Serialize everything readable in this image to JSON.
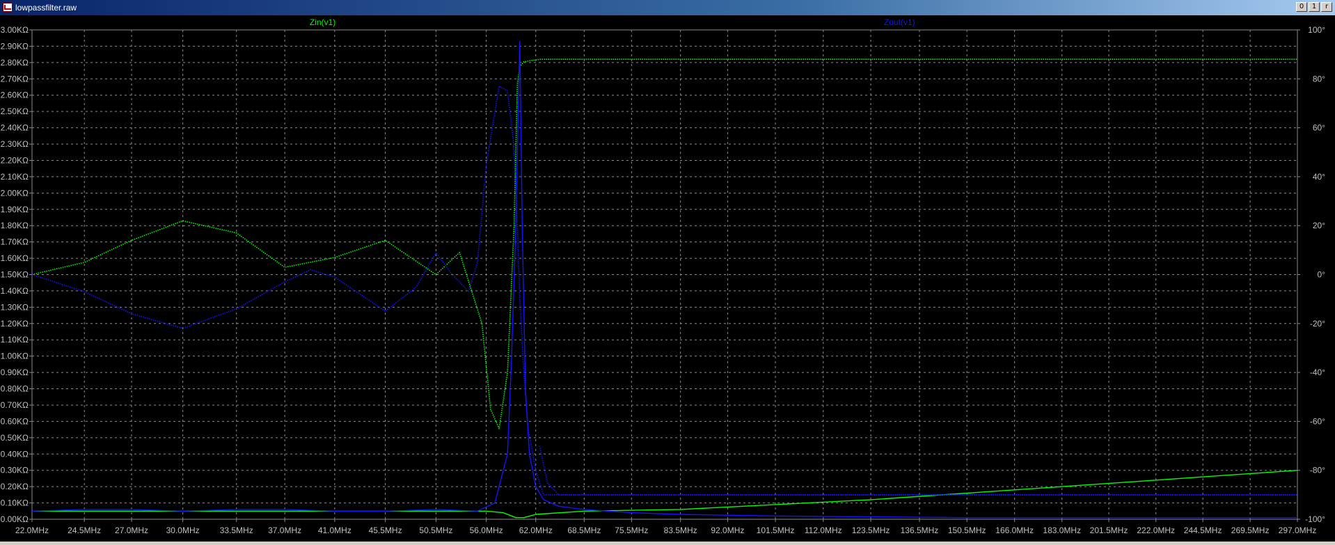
{
  "window": {
    "title": "lowpassfilter.raw",
    "buttons": [
      "0",
      "1",
      "r"
    ]
  },
  "colors": {
    "background": "#000000",
    "grid": "#8c8c8c",
    "axis_text": "#c0c0c0",
    "zin": "#00ff00",
    "zout": "#1414ff"
  },
  "chart_data": {
    "type": "line",
    "x_scale": "log",
    "x_ticks": [
      "22.0MHz",
      "24.5MHz",
      "27.0MHz",
      "30.0MHz",
      "33.5MHz",
      "37.0MHz",
      "41.0MHz",
      "45.5MHz",
      "50.5MHz",
      "56.0MHz",
      "62.0MHz",
      "68.5MHz",
      "75.5MHz",
      "83.5MHz",
      "92.0MHz",
      "101.5MHz",
      "112.0MHz",
      "123.5MHz",
      "136.5MHz",
      "150.5MHz",
      "166.0MHz",
      "183.0MHz",
      "201.5MHz",
      "222.0MHz",
      "244.5MHz",
      "269.5MHz",
      "297.0MHz"
    ],
    "x_tick_values": [
      22.0,
      24.5,
      27.0,
      30.0,
      33.5,
      37.0,
      41.0,
      45.5,
      50.5,
      56.0,
      62.0,
      68.5,
      75.5,
      83.5,
      92.0,
      101.5,
      112.0,
      123.5,
      136.5,
      150.5,
      166.0,
      183.0,
      201.5,
      222.0,
      244.5,
      269.5,
      297.0
    ],
    "xlim": [
      22.0,
      297.0
    ],
    "y_left_ticks": [
      "3.00KΩ",
      "2.90KΩ",
      "2.80KΩ",
      "2.70KΩ",
      "2.60KΩ",
      "2.50KΩ",
      "2.40KΩ",
      "2.30KΩ",
      "2.20KΩ",
      "2.10KΩ",
      "2.00KΩ",
      "1.90KΩ",
      "1.80KΩ",
      "1.70KΩ",
      "1.60KΩ",
      "1.50KΩ",
      "1.40KΩ",
      "1.30KΩ",
      "1.20KΩ",
      "1.10KΩ",
      "1.00KΩ",
      "0.90KΩ",
      "0.80KΩ",
      "0.70KΩ",
      "0.60KΩ",
      "0.50KΩ",
      "0.40KΩ",
      "0.30KΩ",
      "0.20KΩ",
      "0.10KΩ",
      "0.00KΩ"
    ],
    "ylim_left": [
      0,
      3.0
    ],
    "y_right_ticks": [
      "100°",
      "80°",
      "60°",
      "40°",
      "20°",
      "0°",
      "-20°",
      "-40°",
      "-60°",
      "-80°",
      "-100°"
    ],
    "ylim_right": [
      -100,
      100
    ],
    "grid": true,
    "legend_position": "top",
    "series": [
      {
        "name": "Zin(v1)",
        "kind": "magnitude",
        "axis": "left",
        "style": "solid",
        "x": [
          22.0,
          24.5,
          27.0,
          30.0,
          33.5,
          37.0,
          41.0,
          45.5,
          50.5,
          54.0,
          56.0,
          58.0,
          59.0,
          59.5,
          60.5,
          62.0,
          68.5,
          83.5,
          101.5,
          123.5,
          150.5,
          183.0,
          222.0,
          269.5,
          297.0
        ],
        "y": [
          0.05,
          0.05,
          0.05,
          0.05,
          0.05,
          0.05,
          0.05,
          0.05,
          0.05,
          0.05,
          0.05,
          0.04,
          0.02,
          0.01,
          0.01,
          0.03,
          0.05,
          0.06,
          0.09,
          0.12,
          0.16,
          0.2,
          0.24,
          0.28,
          0.3
        ]
      },
      {
        "name": "Zin(v1)",
        "kind": "phase",
        "axis": "right",
        "style": "dotted",
        "x": [
          22.0,
          24.5,
          27.0,
          30.0,
          33.5,
          37.0,
          41.0,
          45.5,
          50.5,
          53.0,
          55.5,
          56.5,
          57.5,
          58.5,
          59.3,
          59.7,
          60.0,
          60.5,
          61.5,
          62.5,
          68.5,
          101.5,
          297.0
        ],
        "y": [
          0,
          5,
          14,
          22,
          17,
          3,
          7,
          14,
          0,
          9,
          -20,
          -55,
          -63,
          -40,
          20,
          78,
          85,
          87,
          87.5,
          88,
          88,
          88,
          88
        ]
      },
      {
        "name": "Zout(v1)",
        "kind": "magnitude",
        "axis": "left",
        "style": "solid",
        "x": [
          22.0,
          24.5,
          27.0,
          30.0,
          33.5,
          37.0,
          41.0,
          45.5,
          50.5,
          55.0,
          57.0,
          58.5,
          59.0,
          59.5,
          60.0,
          60.3,
          60.7,
          61.2,
          62.0,
          63.0,
          65.0,
          68.5,
          75.5,
          83.5,
          101.5,
          150.5,
          297.0
        ],
        "y": [
          0.05,
          0.06,
          0.06,
          0.05,
          0.06,
          0.06,
          0.05,
          0.05,
          0.06,
          0.05,
          0.1,
          0.4,
          1.0,
          1.8,
          2.93,
          1.8,
          0.8,
          0.4,
          0.2,
          0.12,
          0.08,
          0.06,
          0.04,
          0.03,
          0.02,
          0.01,
          0.01
        ]
      },
      {
        "name": "Zout(v1)",
        "kind": "phase",
        "axis": "right",
        "style": "dotted",
        "x": [
          22.0,
          24.5,
          27.0,
          30.0,
          33.5,
          37.0,
          39.0,
          41.0,
          45.5,
          48.5,
          50.5,
          52.0,
          54.0,
          55.0,
          56.0,
          57.5,
          58.5,
          59.2,
          59.6,
          60.0,
          60.5,
          61.0,
          62.0,
          63.0,
          68.5,
          101.5,
          297.0
        ],
        "y": [
          0,
          -7,
          -16,
          -22,
          -14,
          -3,
          2,
          -1,
          -15,
          -5,
          9,
          1,
          -7,
          5,
          45,
          77,
          75,
          55,
          30,
          -10,
          -40,
          -62,
          -80,
          -90,
          -90,
          -90,
          -90
        ]
      },
      {
        "name": "Zout(v1)",
        "kind": "phase-tail",
        "axis": "right",
        "style": "dotted",
        "x": [
          62.5,
          63.5,
          65.0,
          68.5,
          101.5,
          297.0
        ],
        "y": [
          -70,
          -85,
          -90,
          -90,
          -90,
          -90
        ]
      }
    ],
    "legend": [
      {
        "name": "Zin(v1)",
        "color": "#00ff00"
      },
      {
        "name": "Zout(v1)",
        "color": "#1414ff"
      }
    ]
  }
}
